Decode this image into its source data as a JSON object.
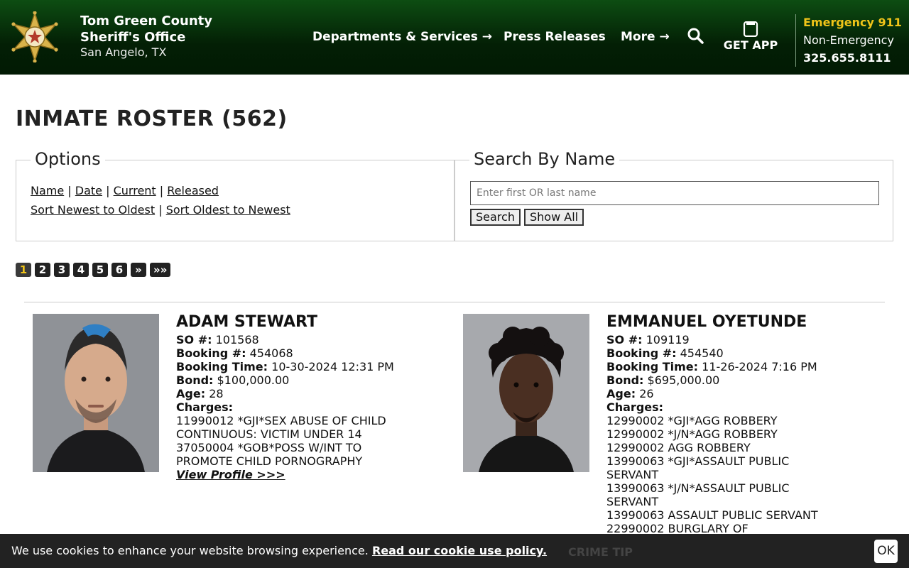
{
  "header": {
    "org_line1": "Tom Green County",
    "org_line2": "Sheriff's Office",
    "location": "San Angelo, TX",
    "nav": [
      {
        "label": "Departments & Services"
      },
      {
        "label": "Press Releases"
      },
      {
        "label": "More"
      }
    ],
    "get_app_label": "GET APP",
    "emergency_label": "Emergency 911",
    "nonemergency_label": "Non-Emergency",
    "phone": "325.655.8111"
  },
  "page": {
    "title": "INMATE ROSTER (562)"
  },
  "options": {
    "legend": "Options",
    "sort_fields": [
      "Name",
      "Date",
      "Current",
      "Released"
    ],
    "sort_orders": [
      "Sort Newest to Oldest",
      "Sort Oldest to Newest"
    ],
    "sep": "|"
  },
  "search": {
    "legend": "Search By Name",
    "placeholder": "Enter first OR last name",
    "search_label": "Search",
    "show_all_label": "Show All"
  },
  "pagination": {
    "pages": [
      "1",
      "2",
      "3",
      "4",
      "5",
      "6",
      "»",
      "»»"
    ],
    "current": "1"
  },
  "labels": {
    "so": "SO #:",
    "booking": "Booking #:",
    "booking_time": "Booking Time:",
    "bond": "Bond:",
    "age": "Age:",
    "charges": "Charges:",
    "view_profile": "View Profile >>>"
  },
  "inmates": [
    {
      "name": "ADAM STEWART",
      "so": "101568",
      "booking": "454068",
      "booking_time": "10-30-2024 12:31 PM",
      "bond": "$100,000.00",
      "age": "28",
      "charges": [
        "11990012 *GJI*SEX ABUSE OF CHILD\nCONTINUOUS: VICTIM UNDER 14",
        "37050004 *GOB*POSS W/INT TO\nPROMOTE CHILD PORNOGRAPHY"
      ]
    },
    {
      "name": "EMMANUEL OYETUNDE",
      "so": "109119",
      "booking": "454540",
      "booking_time": "11-26-2024 7:16 PM",
      "bond": "$695,000.00",
      "age": "26",
      "charges": [
        "12990002 *GJI*AGG ROBBERY",
        "12990002 *J/N*AGG ROBBERY",
        "12990002 AGG ROBBERY",
        "13990063 *GJI*ASSAULT PUBLIC\nSERVANT",
        "13990063 *J/N*ASSAULT PUBLIC\nSERVANT",
        "13990063 ASSAULT PUBLIC SERVANT",
        "22990002 BURGLARY OF"
      ]
    }
  ],
  "cookie": {
    "message": "We use cookies to enhance your website browsing experience.",
    "policy_link": "Read our cookie use policy.",
    "behind_text": "CRIME TIP",
    "ok_label": "OK"
  },
  "colors": {
    "header_green": "#0d4d12",
    "accent_gold": "#f0c419",
    "cookie_bg": "#222222"
  }
}
